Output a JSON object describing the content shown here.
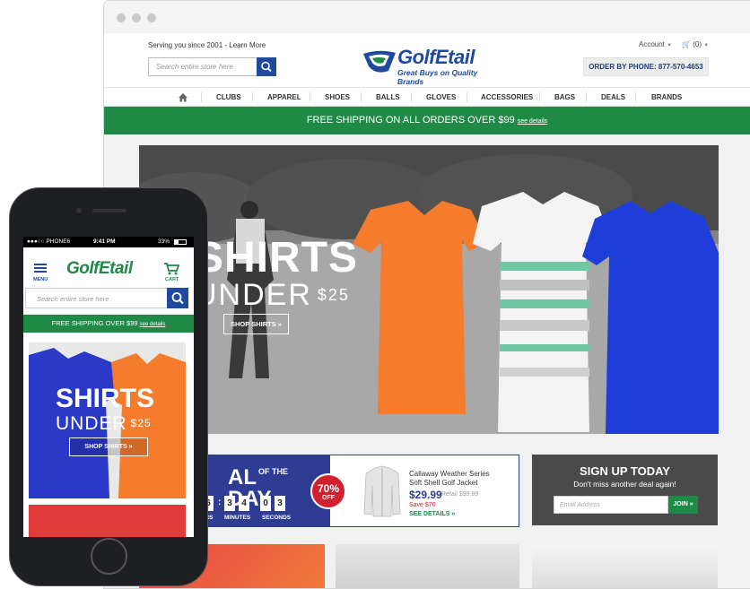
{
  "desktop": {
    "header": {
      "serving": "Serving you since 2001 - Learn More",
      "search_placeholder": "Search entire store here",
      "logo_text": "GolfEtail",
      "logo_tagline": "Great Buys on Quality Brands",
      "account": "Account",
      "cart": "(0)",
      "order_by_phone": "ORDER BY PHONE: 877-570-4653"
    },
    "nav": [
      "CLUBS",
      "APPAREL",
      "SHOES",
      "BALLS",
      "GLOVES",
      "ACCESSORIES",
      "BAGS",
      "DEALS",
      "BRANDS"
    ],
    "shipping": {
      "text": "FREE SHIPPING ON ALL ORDERS OVER $99",
      "link": "see details"
    },
    "hero": {
      "title": "SHIRTS",
      "sub_prefix": "UNDER",
      "sub_price": "$25",
      "button": "SHOP SHIRTS »"
    },
    "deal": {
      "of_the": "OF THE",
      "title_start": "AL",
      "title_end": "DAY",
      "digits": [
        "6",
        "3",
        "4",
        "0",
        "3"
      ],
      "labels": [
        "HOURS",
        "MINUTES",
        "SECONDS"
      ],
      "badge_percent": "70%",
      "badge_off": "OFF",
      "product": "Callaway Weather Series Soft Shell Golf Jacket",
      "price": "$29.99",
      "retail": "Retail $99.99",
      "save": "Save $70",
      "details": "SEE DETAILS »"
    },
    "signup": {
      "title": "SIGN UP TODAY",
      "sub": "Don't miss another deal again!",
      "placeholder": "Email Address",
      "button": "JOIN »"
    }
  },
  "mobile": {
    "status": {
      "carrier": "●●●○○ PHONE6",
      "time": "9:41 PM",
      "battery": "33%"
    },
    "menu_label": "MENU",
    "logo_text": "GolfEtail",
    "cart_label": "CART",
    "search_placeholder": "Search entire store here",
    "shipping": {
      "text": "FREE SHIPPING OVER $99",
      "link": "see details"
    },
    "hero": {
      "title": "SHIRTS",
      "sub_prefix": "UNDER",
      "sub_price": "$25",
      "button": "SHOP SHIRTS »"
    }
  },
  "colors": {
    "brand_blue": "#1f4a9e",
    "brand_green": "#1f8a46",
    "deal_red": "#d2202f",
    "deal_navy": "#2f3c93"
  }
}
